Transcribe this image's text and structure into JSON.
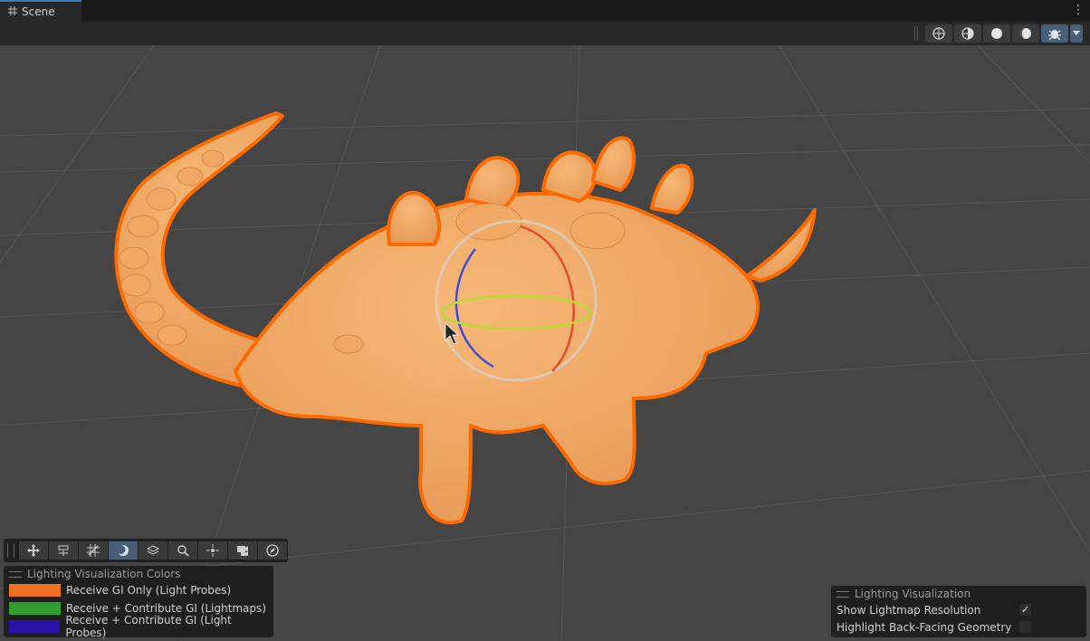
{
  "tabs": [
    {
      "label": "Scene",
      "icon": "grid-icon"
    }
  ],
  "scene_toolbar": {
    "buttons": [
      {
        "name": "wireframe-shading",
        "icon": "wireframe-sphere-icon",
        "active": false
      },
      {
        "name": "shaded-wireframe",
        "icon": "shaded-wireframe-sphere-icon",
        "active": false
      },
      {
        "name": "shaded",
        "icon": "solid-sphere-icon",
        "active": false
      },
      {
        "name": "lighting-mode",
        "icon": "half-lit-sphere-icon",
        "active": false
      },
      {
        "name": "debug-draw-mode",
        "icon": "bug-icon",
        "active": true
      }
    ]
  },
  "overlay_toolbar": {
    "buttons": [
      {
        "name": "move-tool",
        "icon": "move-arrows-icon",
        "active": false
      },
      {
        "name": "rect-tool",
        "icon": "sliders-icon",
        "active": false
      },
      {
        "name": "grid-snapping",
        "icon": "grid-snap-icon",
        "active": false
      },
      {
        "name": "lighting-visualization",
        "icon": "moon-sphere-icon",
        "active": true
      },
      {
        "name": "orientation-tool",
        "icon": "layers-icon",
        "active": false
      },
      {
        "name": "search-tool",
        "icon": "search-icon",
        "active": false
      },
      {
        "name": "pivot-tool",
        "icon": "pivot-icon",
        "active": false
      },
      {
        "name": "camera-tool",
        "icon": "camera-eye-icon",
        "active": false
      },
      {
        "name": "navigation-tool",
        "icon": "compass-icon",
        "active": false
      }
    ]
  },
  "legend": {
    "title": "Lighting Visualization Colors",
    "items": [
      {
        "label": "Receive GI Only (Light Probes)",
        "color": "#f07020"
      },
      {
        "label": "Receive + Contribute GI (Lightmaps)",
        "color": "#2f9e2f"
      },
      {
        "label": "Receive + Contribute GI (Light Probes)",
        "color": "#2a12a8"
      }
    ]
  },
  "lighting_visualization": {
    "title": "Lighting Visualization",
    "options": [
      {
        "label": "Show Lightmap Resolution",
        "checked": true,
        "check": "✓"
      },
      {
        "label": "Highlight Back-Facing Geometry",
        "checked": false,
        "check": ""
      }
    ]
  },
  "colors": {
    "model_fill": "#f4aa66",
    "selection_outline": "#ff6a00",
    "viewport_bg": "#454545",
    "accent": "#3a79bb"
  }
}
